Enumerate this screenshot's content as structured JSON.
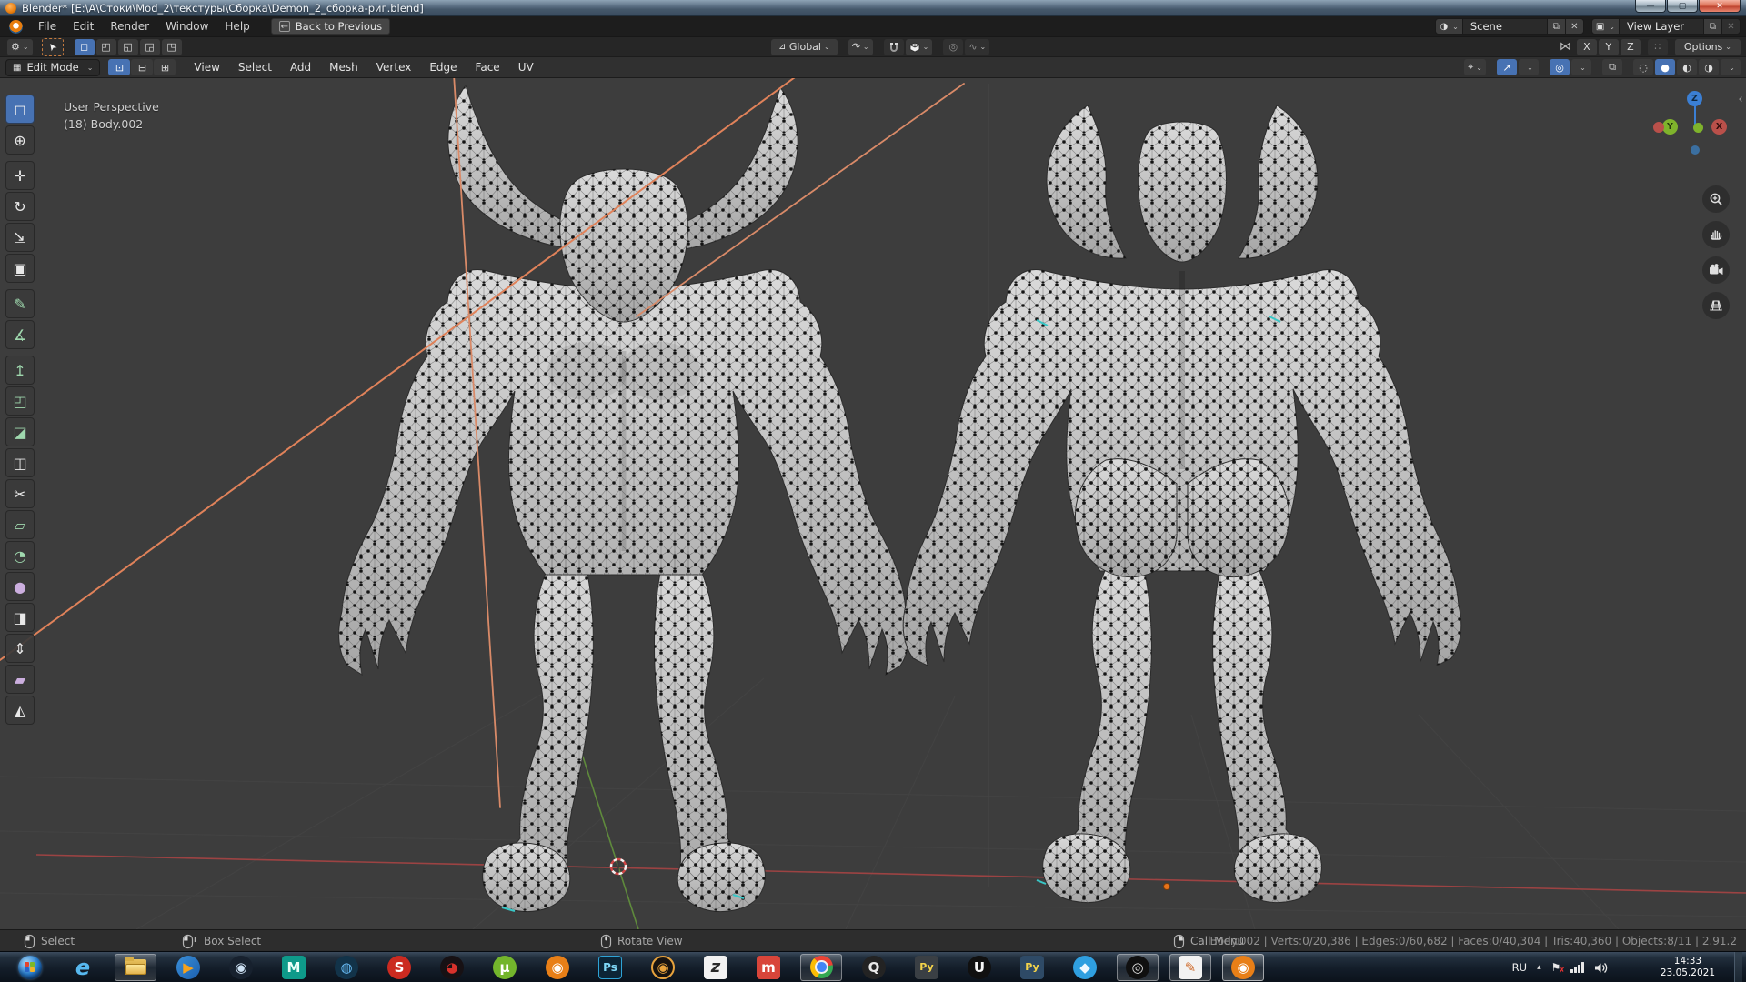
{
  "window": {
    "title": "Blender* [E:\\A\\Стоки\\Mod_2\\текстуры\\Сборка\\Demon_2_сборка-риг.blend]"
  },
  "topbar": {
    "menus": [
      "File",
      "Edit",
      "Render",
      "Window",
      "Help"
    ],
    "back_button": "Back to Previous",
    "scene_label": "Scene",
    "view_layer_label": "View Layer"
  },
  "tool_settings": {
    "orientation": "Global",
    "mirror_axes": [
      "X",
      "Y",
      "Z"
    ],
    "options_label": "Options"
  },
  "viewport_header": {
    "mode": "Edit Mode",
    "menus": [
      "View",
      "Select",
      "Add",
      "Mesh",
      "Vertex",
      "Edge",
      "Face",
      "UV"
    ]
  },
  "viewport": {
    "overlay_line1": "User Perspective",
    "overlay_line2": "(18) Body.002",
    "gizmo": {
      "x": "X",
      "y": "Y",
      "z": "Z"
    }
  },
  "toolbar": {
    "tools": [
      {
        "name": "select-box",
        "glyph": "◻",
        "color": "#f2f2f2",
        "active": true
      },
      {
        "name": "cursor",
        "glyph": "⊕",
        "color": "#e8e8e8"
      },
      {
        "name": "move",
        "glyph": "✛",
        "color": "#e8e8e8"
      },
      {
        "name": "rotate",
        "glyph": "↻",
        "color": "#e8e8e8"
      },
      {
        "name": "scale",
        "glyph": "⇲",
        "color": "#e8e8e8"
      },
      {
        "name": "transform",
        "glyph": "▣",
        "color": "#e8e8e8"
      },
      {
        "name": "annotate",
        "glyph": "✎",
        "color": "#9fd8ae"
      },
      {
        "name": "measure",
        "glyph": "∡",
        "color": "#9fd8ae"
      },
      {
        "name": "extrude-region",
        "glyph": "↥",
        "color": "#9fd8ae"
      },
      {
        "name": "inset-faces",
        "glyph": "◰",
        "color": "#9fd8ae"
      },
      {
        "name": "bevel",
        "glyph": "◪",
        "color": "#9fd8ae"
      },
      {
        "name": "loop-cut",
        "glyph": "◫",
        "color": "#e8e8e8"
      },
      {
        "name": "knife",
        "glyph": "✂",
        "color": "#e8e8e8"
      },
      {
        "name": "poly-build",
        "glyph": "▱",
        "color": "#9fd8ae"
      },
      {
        "name": "spin",
        "glyph": "◔",
        "color": "#9fd8ae"
      },
      {
        "name": "smooth",
        "glyph": "●",
        "color": "#cbaede"
      },
      {
        "name": "edge-slide",
        "glyph": "◨",
        "color": "#e8e8e8"
      },
      {
        "name": "shrink-fatten",
        "glyph": "⇕",
        "color": "#e8e8e8"
      },
      {
        "name": "shear",
        "glyph": "▰",
        "color": "#cbaede"
      },
      {
        "name": "rip-region",
        "glyph": "◭",
        "color": "#e8e8e8"
      }
    ]
  },
  "status_bar": {
    "hints": [
      {
        "button": "left-mouse",
        "label": "Select"
      },
      {
        "button": "left-mouse-drag",
        "label": "Box Select"
      },
      {
        "button": "middle-mouse",
        "label": "Rotate View"
      },
      {
        "button": "right-mouse",
        "label": "Call Menu"
      }
    ],
    "stats": "Body.002 | Verts:0/20,386 | Edges:0/60,682 | Faces:0/40,304 | Tris:40,360 | Objects:8/11 | 2.91.2"
  },
  "taskbar": {
    "language": "RU",
    "time": "14:33",
    "date": "23.05.2021",
    "icons": [
      {
        "name": "start",
        "glyph": "",
        "bg": "",
        "fg": ""
      },
      {
        "name": "internet-explorer",
        "glyph": "e",
        "bg": "transparent",
        "fg": "#57b8ef"
      },
      {
        "name": "windows-explorer",
        "glyph": "",
        "bg": "",
        "fg": "",
        "active": true
      },
      {
        "name": "media-player",
        "glyph": "▶",
        "bg": "linear-gradient(135deg,#3a8fd8,#1b5fae)",
        "fg": "#f6a21c"
      },
      {
        "name": "steam",
        "glyph": "◉",
        "bg": "#17212e",
        "fg": "#cfe3f5"
      },
      {
        "name": "maya",
        "glyph": "M",
        "bg": "#0e9a8a",
        "fg": "#eafff9"
      },
      {
        "name": "aperture-app",
        "glyph": "◍",
        "bg": "#123349",
        "fg": "#66b9f2"
      },
      {
        "name": "substance-painter",
        "glyph": "S",
        "bg": "#cb2a20",
        "fg": "#ffffff"
      },
      {
        "name": "dark-red-app",
        "glyph": "◕",
        "bg": "#171114",
        "fg": "#d8322c"
      },
      {
        "name": "utorrent",
        "glyph": "µ",
        "bg": "#73b52c",
        "fg": "#ffffff"
      },
      {
        "name": "blender",
        "glyph": "◉",
        "bg": "#e87f17",
        "fg": "#ffffff"
      },
      {
        "name": "photoshop",
        "glyph": "Ps",
        "bg": "#0c2536",
        "fg": "#7fd8f7"
      },
      {
        "name": "marmoset-toolbag",
        "glyph": "◉",
        "bg": "#171310",
        "fg": "#e8a33d"
      },
      {
        "name": "zbrush",
        "glyph": "z",
        "bg": "#f2f2f2",
        "fg": "#2a2a2a"
      },
      {
        "name": "red-m-app",
        "glyph": "m",
        "bg": "#d8453a",
        "fg": "#ffffff"
      },
      {
        "name": "chrome",
        "glyph": "",
        "bg": "",
        "fg": "",
        "active": true
      },
      {
        "name": "pureref",
        "glyph": "Q",
        "bg": "#232323",
        "fg": "#e8e8e8"
      },
      {
        "name": "python-file",
        "glyph": "Py",
        "bg": "#3a3f44",
        "fg": "#f5d44a"
      },
      {
        "name": "unreal-engine",
        "glyph": "U",
        "bg": "#101010",
        "fg": "#f5f5f5"
      },
      {
        "name": "python-console",
        "glyph": "Py",
        "bg": "#2e4a66",
        "fg": "#f5d44a"
      },
      {
        "name": "blue-pin-app",
        "glyph": "◆",
        "bg": "#2f9fe0",
        "fg": "#eef8ff"
      },
      {
        "name": "obs-studio",
        "glyph": "◎",
        "bg": "#101010",
        "fg": "#e0e0e0",
        "active": true
      },
      {
        "name": "paint-app",
        "glyph": "✎",
        "bg": "#f2f2f2",
        "fg": "#cf6a2a",
        "active": true
      },
      {
        "name": "blender-current",
        "glyph": "◉",
        "bg": "#e87f17",
        "fg": "#ffffff",
        "active": true
      }
    ]
  }
}
